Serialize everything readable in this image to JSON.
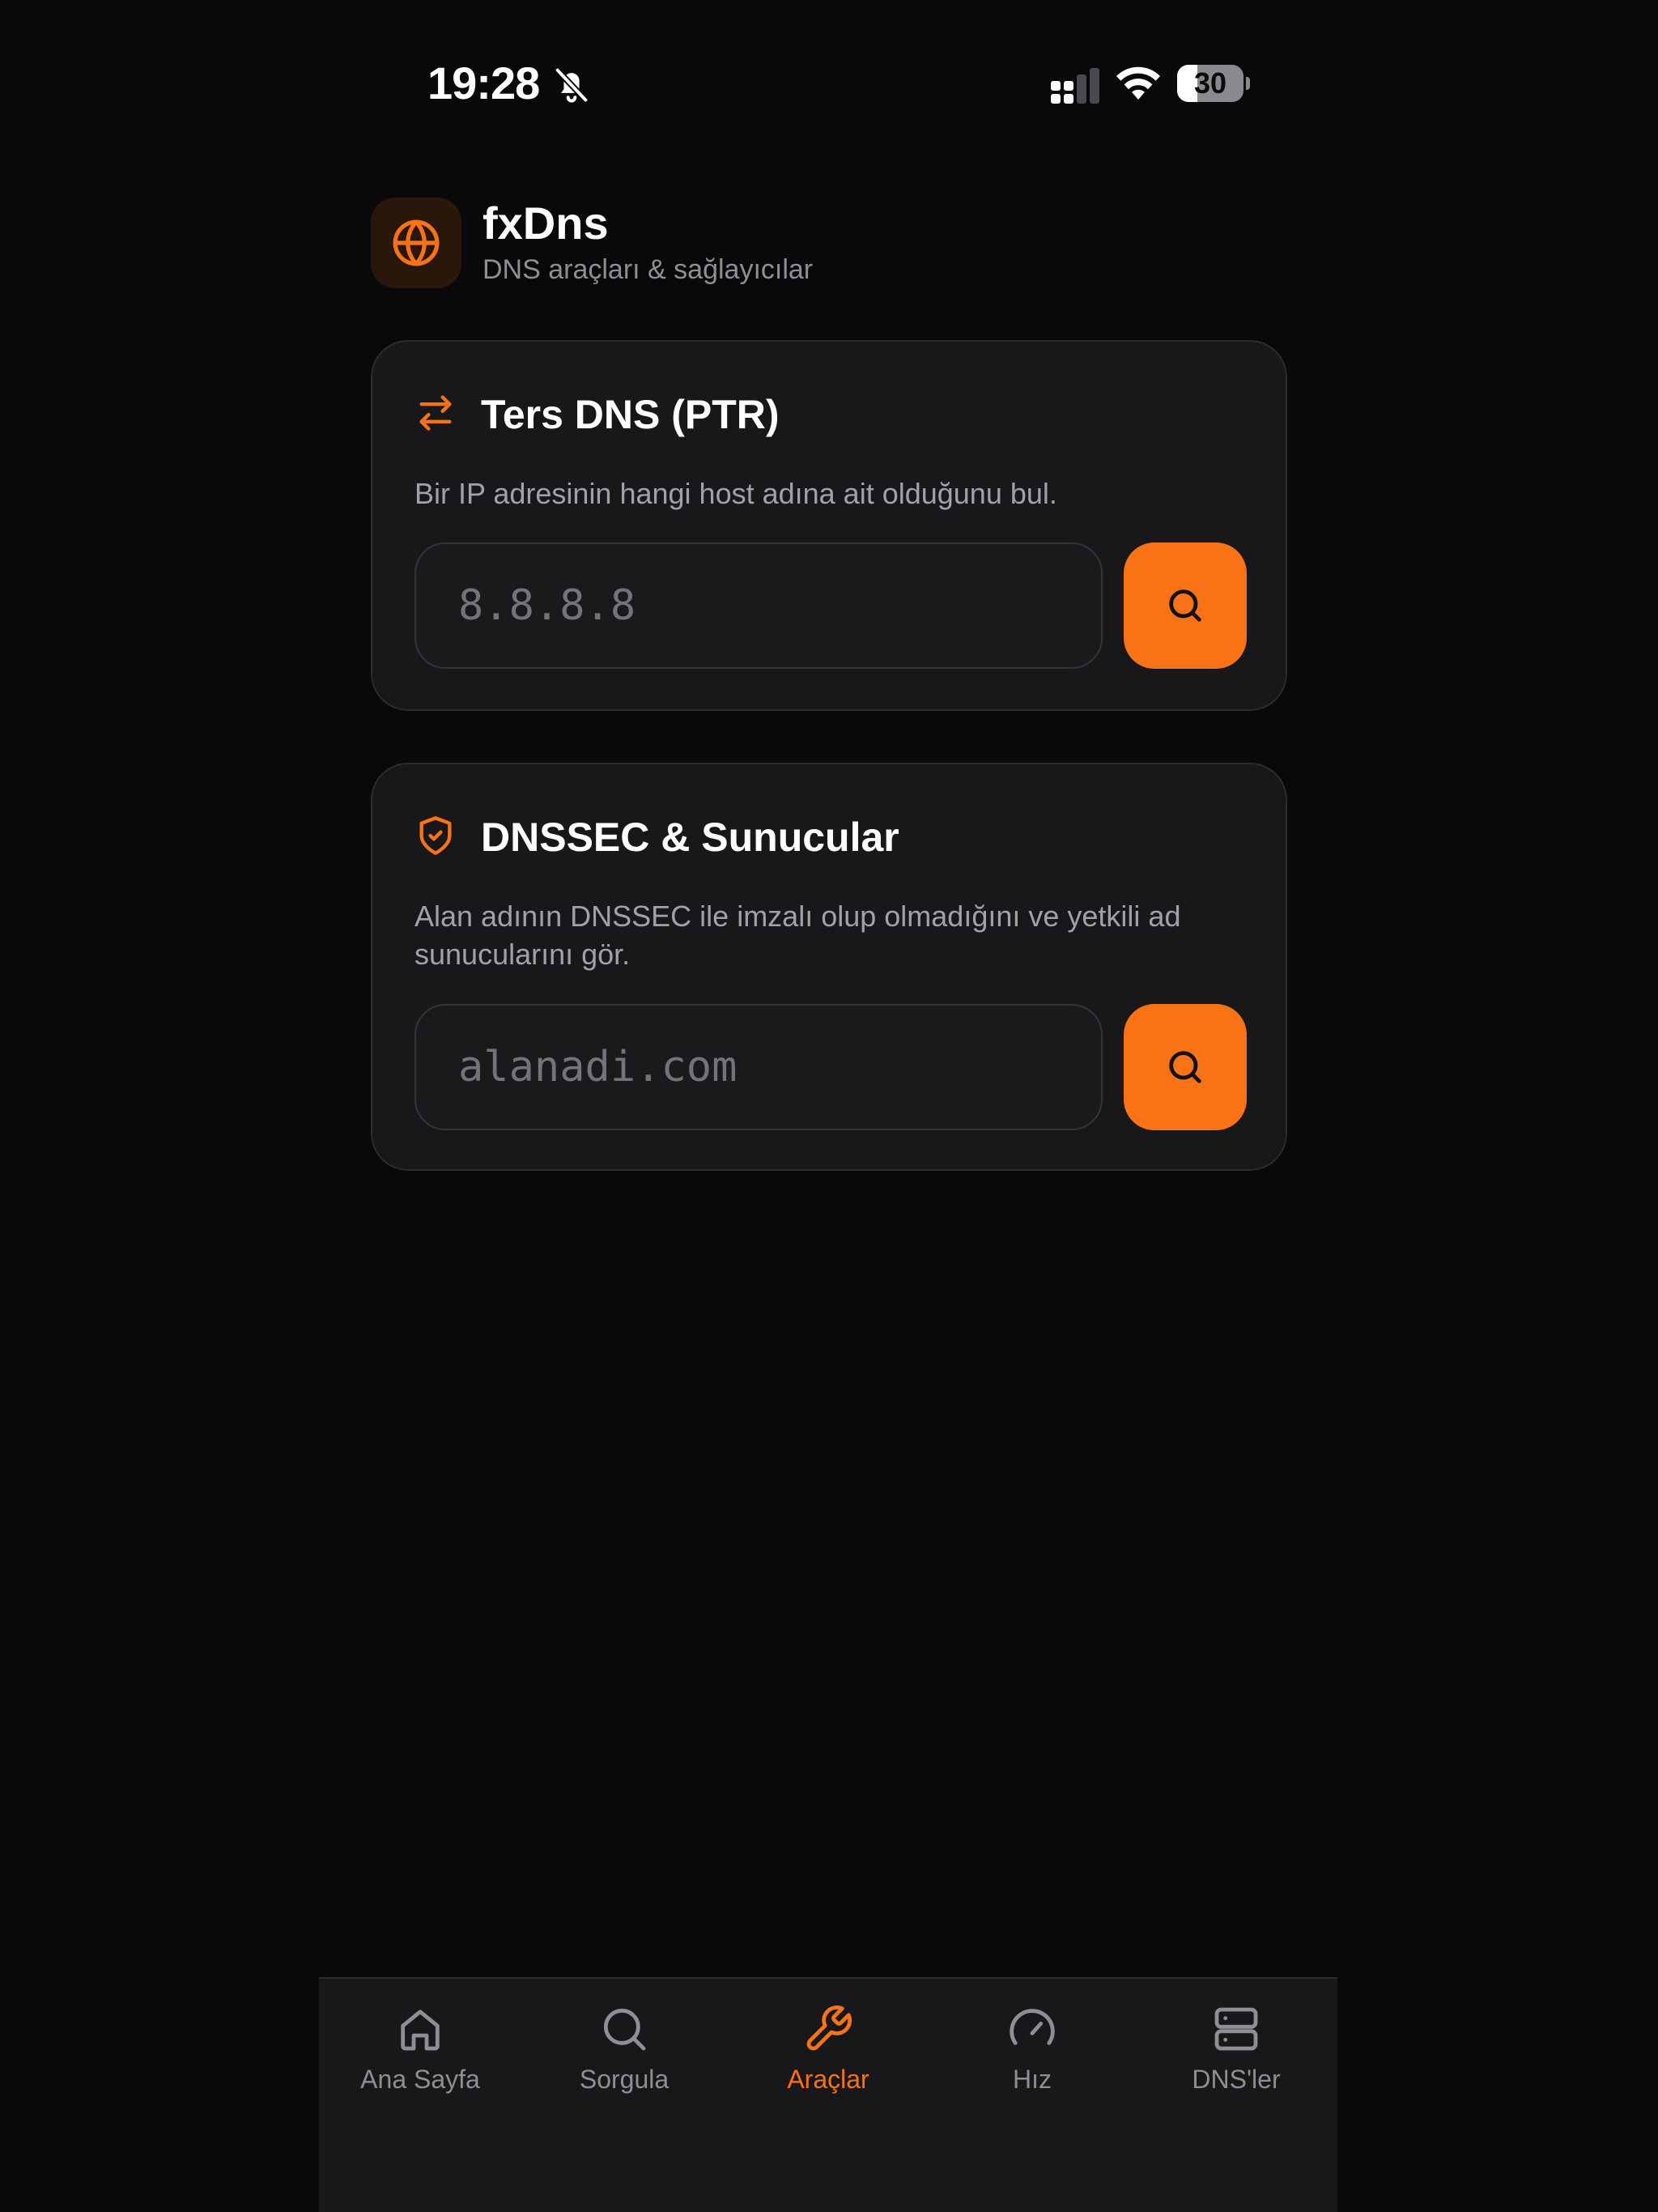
{
  "status_bar": {
    "time": "19:28",
    "battery_level": "30",
    "battery_fraction": 0.3
  },
  "header": {
    "title": "fxDns",
    "subtitle": "DNS araçları & sağlayıcılar",
    "logo_icon": "globe-icon"
  },
  "cards": {
    "ptr": {
      "icon": "arrows-swap-icon",
      "title": "Ters DNS (PTR)",
      "description": "Bir IP adresinin hangi host adına ait olduğunu bul.",
      "input_placeholder": "8.8.8.8",
      "input_value": ""
    },
    "dnssec": {
      "icon": "shield-check-icon",
      "title": "DNSSEC & Sunucular",
      "description": "Alan adının DNSSEC ile imzalı olup olmadığını ve yetkili ad sunucularını gör.",
      "input_placeholder": "alanadi.com",
      "input_value": ""
    }
  },
  "tab_bar": {
    "active": "tools",
    "items": [
      {
        "id": "home",
        "label": "Ana Sayfa",
        "icon": "home-icon"
      },
      {
        "id": "query",
        "label": "Sorgula",
        "icon": "search-icon"
      },
      {
        "id": "tools",
        "label": "Araçlar",
        "icon": "wrench-icon"
      },
      {
        "id": "speed",
        "label": "Hız",
        "icon": "gauge-icon"
      },
      {
        "id": "dns_list",
        "label": "DNS'ler",
        "icon": "server-icon"
      }
    ]
  },
  "colors": {
    "background": "#09090b",
    "card": "#18181b",
    "accent": "#f97316",
    "muted_text": "#8e8e93"
  }
}
